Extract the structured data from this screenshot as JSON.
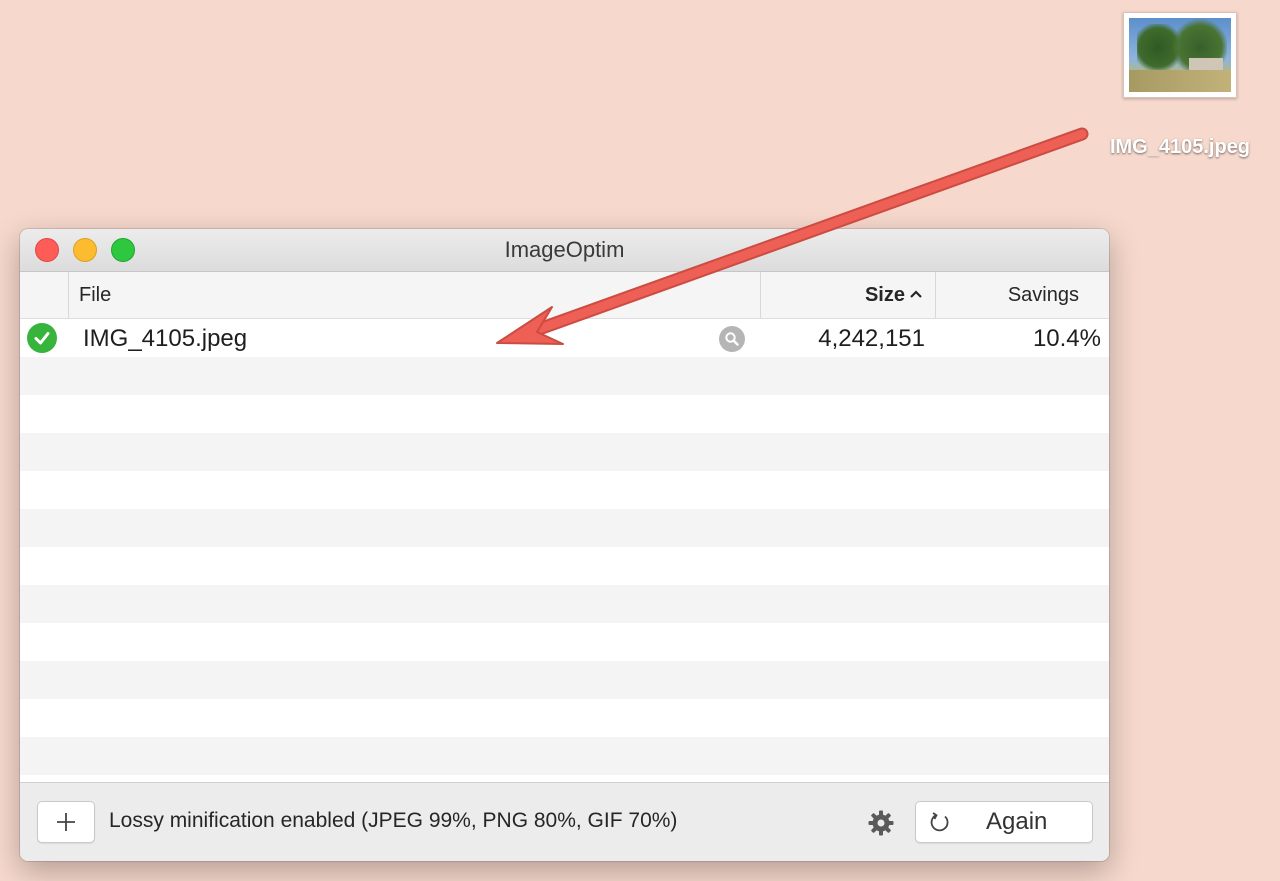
{
  "desktop": {
    "file_label": "IMG_4105.jpeg"
  },
  "window": {
    "title": "ImageOptim",
    "columns": {
      "file": "File",
      "size": "Size",
      "size_sort_icon": "chevron-up-icon",
      "savings": "Savings"
    },
    "rows": [
      {
        "status_icon": "checkmark-circle-icon",
        "name": "IMG_4105.jpeg",
        "size": "4,242,151",
        "savings": "10.4%"
      }
    ],
    "footer": {
      "add_label": "+",
      "status": "Lossy minification enabled (JPEG 99%, PNG 80%, GIF 70%)",
      "again_label": "Again"
    }
  },
  "colors": {
    "desktop_bg": "#f6d8cc",
    "arrow": "#e85a4f",
    "success_green": "#36b43c",
    "traffic_red": "#fd5d56",
    "traffic_yellow": "#fdbb2f",
    "traffic_green": "#2dc840"
  }
}
